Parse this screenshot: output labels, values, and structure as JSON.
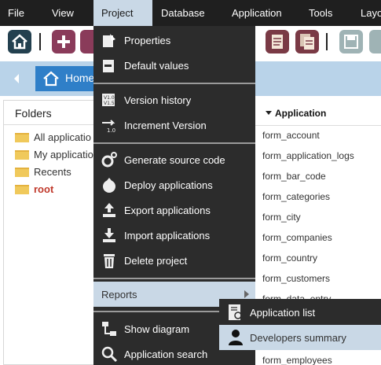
{
  "menubar": {
    "items": [
      {
        "label": "File"
      },
      {
        "label": "View"
      },
      {
        "label": "Project",
        "active": true
      },
      {
        "label": "Database"
      },
      {
        "label": "Application"
      },
      {
        "label": "Tools"
      },
      {
        "label": "Layo"
      }
    ]
  },
  "toolbar": {
    "buttons": [
      "home-icon",
      "add-icon",
      "app-icon",
      "document-icon",
      "documents-icon",
      "save-icon",
      "gear-icon"
    ]
  },
  "breadcrumb": {
    "home_label": "Home"
  },
  "folders": {
    "title": "Folders",
    "items": [
      {
        "label": "All applicatio"
      },
      {
        "label": "My applicatio"
      },
      {
        "label": "Recents"
      },
      {
        "label": "root"
      }
    ]
  },
  "applications": {
    "column_header": "Application",
    "rows": [
      "form_account",
      "form_application_logs",
      "form_bar_code",
      "form_categories",
      "form_city",
      "form_companies",
      "form_country",
      "form_customers",
      "form_data_entry",
      "form_employees",
      "form_employees"
    ]
  },
  "project_menu": {
    "items": [
      {
        "label": "Properties",
        "icon": "properties-icon"
      },
      {
        "label": "Default values",
        "icon": "default-values-icon"
      },
      {
        "label": "Version history",
        "icon": "version-history-icon"
      },
      {
        "label": "Increment Version",
        "icon": "increment-version-icon"
      },
      {
        "label": "Generate source code",
        "icon": "generate-code-icon"
      },
      {
        "label": "Deploy applications",
        "icon": "deploy-icon"
      },
      {
        "label": "Export applications",
        "icon": "export-icon"
      },
      {
        "label": "Import applications",
        "icon": "import-icon"
      },
      {
        "label": "Delete project",
        "icon": "trash-icon"
      },
      {
        "label": "Reports",
        "icon": ""
      },
      {
        "label": "Show diagram",
        "icon": "diagram-icon"
      },
      {
        "label": "Application search",
        "icon": "search-icon"
      }
    ]
  },
  "reports_submenu": {
    "items": [
      {
        "label": "Application list",
        "icon": "application-list-icon"
      },
      {
        "label": "Developers summary",
        "icon": "developer-icon"
      }
    ]
  },
  "colors": {
    "menubar_bg": "#1f1f1f",
    "menu_bg": "#2c2c2c",
    "highlight": "#c9d8e6",
    "accent_blue": "#2f7fc8",
    "strip_blue": "#b9d3e9",
    "root_red": "#c0392b"
  }
}
